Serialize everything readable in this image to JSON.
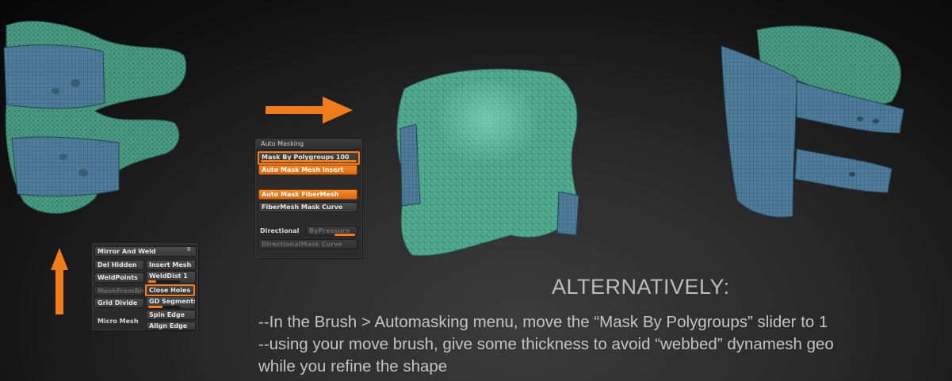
{
  "colors": {
    "accent": "#f07d1a",
    "mesh_green": "#4fa58a",
    "mesh_blue": "#4f7f9c",
    "background": "#1a1a1a"
  },
  "illustrations": {
    "left_mesh": "dynamesh-model-with-blue-polygroup-bands",
    "center_mesh": "dynamesh-model-result",
    "right_mesh": "dynamesh-model-thickened"
  },
  "arrows": {
    "right_arrow_icon": "arrow-right-icon",
    "up_arrow_icon": "arrow-up-icon"
  },
  "auto_masking_panel": {
    "title": "Auto Masking",
    "mask_by_polygroups_label": "Mask By Polygroups",
    "mask_by_polygroups_value": "100",
    "mask_by_polygroups_fraction": 1.0,
    "auto_mask_mesh_insert": "Auto Mask Mesh Insert",
    "auto_mask_fibermesh": "Auto Mask FiberMesh",
    "fibermesh_mask_curve": "FiberMesh Mask Curve",
    "directional": "Directional",
    "by_pressure": "ByPressure",
    "directional_mask_curve": "DirectionalMask Curve"
  },
  "mirror_weld_panel": {
    "title": "Mirror And Weld",
    "del_hidden": "Del Hidden",
    "insert_mesh": "Insert Mesh",
    "weld_points": "WeldPoints",
    "weld_dist_label": "WeldDist",
    "weld_dist_value": "1",
    "mesh_from_brush": "MeshFromBrush",
    "close_holes": "Close Holes",
    "grid_divide": "Grid Divide",
    "gd_segments": "GD Segments",
    "spin_edge": "Spin Edge",
    "micro_mesh": "Micro Mesh",
    "align_edge": "Align Edge"
  },
  "text": {
    "headline": "ALTERNATIVELY:",
    "line1": "--In the Brush > Automasking menu, move the “Mask By Polygroups” slider to 1",
    "line2": "--using your move brush, give some thickness to avoid “webbed” dynamesh geo",
    "line3": "while you refine the shape"
  }
}
